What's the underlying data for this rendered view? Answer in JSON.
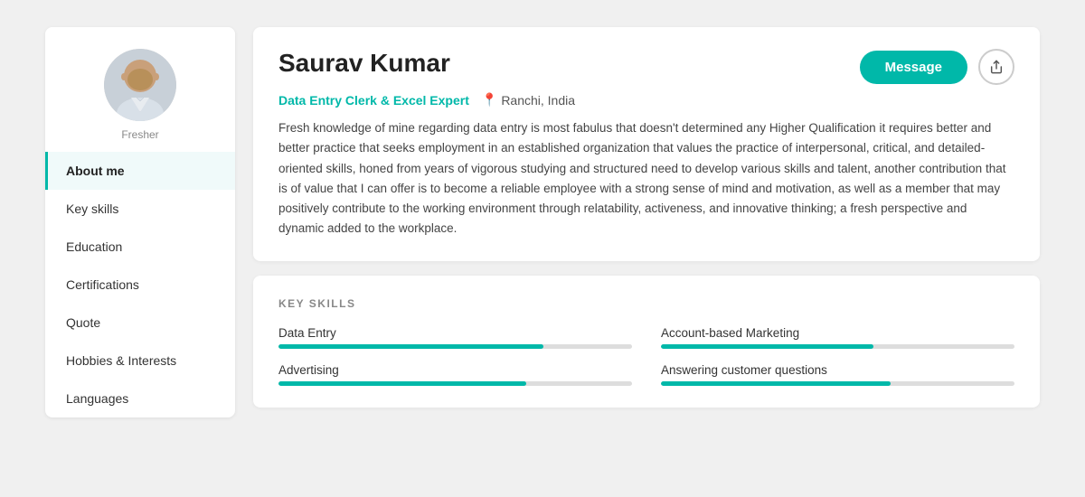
{
  "sidebar": {
    "fresher_label": "Fresher",
    "nav_items": [
      {
        "label": "About me",
        "active": true
      },
      {
        "label": "Key skills",
        "active": false
      },
      {
        "label": "Education",
        "active": false
      },
      {
        "label": "Certifications",
        "active": false
      },
      {
        "label": "Quote",
        "active": false
      },
      {
        "label": "Hobbies & Interests",
        "active": false
      },
      {
        "label": "Languages",
        "active": false
      }
    ]
  },
  "profile": {
    "name": "Saurav Kumar",
    "role": "Data Entry Clerk & Excel Expert",
    "location": "Ranchi, India",
    "bio": "Fresh knowledge of mine regarding data entry is most fabulus that doesn't determined any Higher Qualification it requires better and better practice that seeks employment in an established organization that values the practice of interpersonal, critical, and detailed-oriented skills, honed from years of vigorous studying and structured need to develop various skills and talent, another contribution that is of value that I can offer is to become a reliable employee with a strong sense of mind and motivation, as well as a member that may positively contribute to the working environment through relatability, activeness, and innovative thinking; a fresh perspective and dynamic added to the workplace.",
    "message_btn": "Message"
  },
  "skills": {
    "section_title": "KEY SKILLS",
    "items": [
      {
        "label": "Data Entry",
        "percent": 75
      },
      {
        "label": "Account-based Marketing",
        "percent": 60
      },
      {
        "label": "Advertising",
        "percent": 70
      },
      {
        "label": "Answering customer questions",
        "percent": 65
      }
    ]
  }
}
